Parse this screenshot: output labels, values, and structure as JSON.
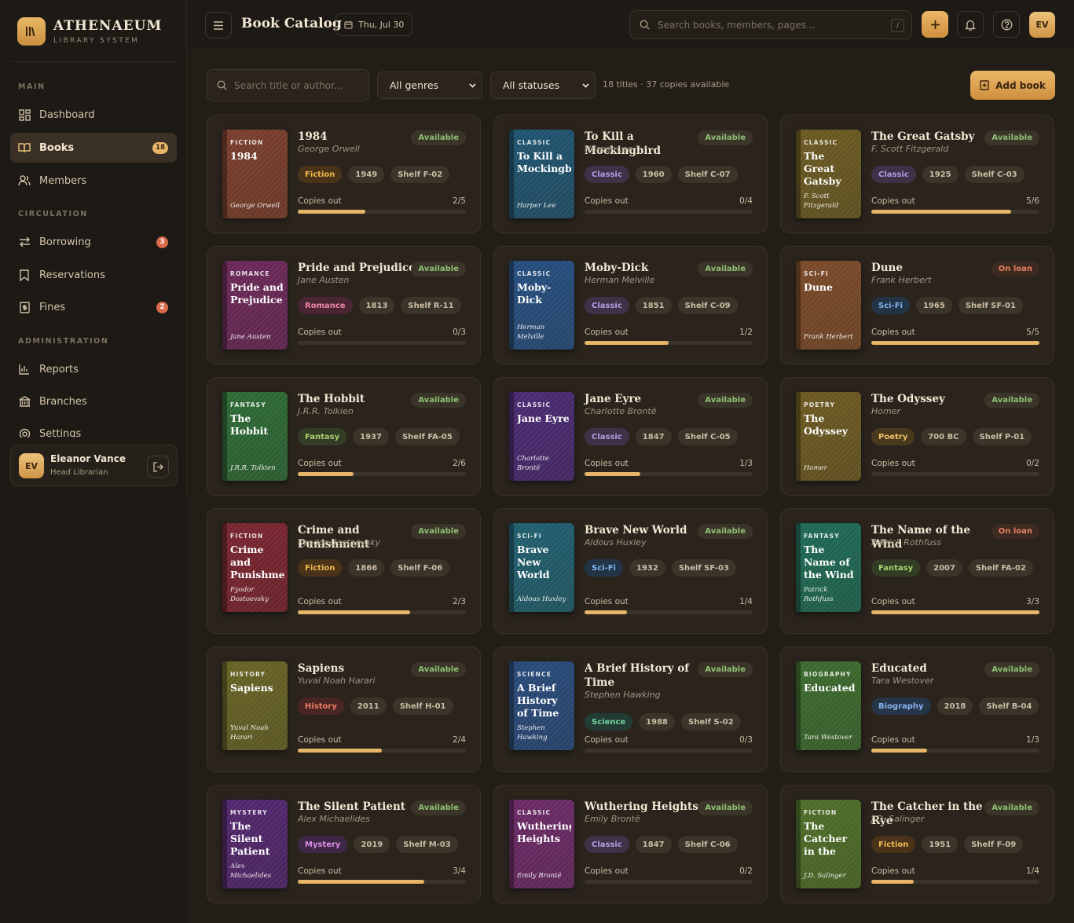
{
  "brand": {
    "name": "ATHENAEUM",
    "subtitle": "LIBRARY SYSTEM"
  },
  "sidebar": {
    "sections": {
      "main": "MAIN",
      "circulation": "CIRCULATION",
      "administration": "ADMINISTRATION"
    },
    "items": [
      {
        "label": "Dashboard",
        "icon": "grid-icon"
      },
      {
        "label": "Books",
        "icon": "book-icon",
        "badge": "18",
        "active": true
      },
      {
        "label": "Members",
        "icon": "users-icon"
      },
      {
        "label": "Borrowing",
        "icon": "swap-icon",
        "badge": "3"
      },
      {
        "label": "Reservations",
        "icon": "bookmark-icon"
      },
      {
        "label": "Fines",
        "icon": "receipt-icon",
        "badge": "2"
      },
      {
        "label": "Reports",
        "icon": "bar-chart-icon"
      },
      {
        "label": "Branches",
        "icon": "building-icon"
      },
      {
        "label": "Settings",
        "icon": "gear-icon"
      }
    ],
    "user": {
      "initials": "EV",
      "name": "Eleanor Vance",
      "role": "Head Librarian"
    }
  },
  "topbar": {
    "title": "Book Catalog",
    "date": "Thu, Jul 30",
    "search_placeholder": "Search books, members, pages...",
    "search_shortcut": "/",
    "user_initials": "EV"
  },
  "filters": {
    "search_placeholder": "Search title or author...",
    "genre": "All genres",
    "status": "All statuses",
    "summary": "18 titles · 37 copies available",
    "add_label": "Add book"
  },
  "copies_label": "Copies out",
  "colors": {
    "accent": "#e6b567",
    "available": "#8fbf74",
    "on_loan": "#e7805e"
  },
  "books": [
    {
      "title": "1984",
      "author": "George Orwell",
      "genre": "Fiction",
      "year": "1949",
      "shelf": "Shelf F-02",
      "status": "Available",
      "out": "2/5",
      "frac": 0.4,
      "cover": "#7a3e2c"
    },
    {
      "title": "To Kill a Mockingbird",
      "author": "Harper Lee",
      "genre": "Classic",
      "year": "1960",
      "shelf": "Shelf C-07",
      "status": "Available",
      "out": "0/4",
      "frac": 0,
      "cover": "#1f5470"
    },
    {
      "title": "The Great Gatsby",
      "author": "F. Scott Fitzgerald",
      "genre": "Classic",
      "year": "1925",
      "shelf": "Shelf C-03",
      "status": "Available",
      "out": "5/6",
      "frac": 0.833,
      "cover": "#6b5a22"
    },
    {
      "title": "Pride and Prejudice",
      "author": "Jane Austen",
      "genre": "Romance",
      "year": "1813",
      "shelf": "Shelf R-11",
      "status": "Available",
      "out": "0/3",
      "frac": 0,
      "cover": "#6b2858"
    },
    {
      "title": "Moby-Dick",
      "author": "Herman Melville",
      "genre": "Classic",
      "year": "1851",
      "shelf": "Shelf C-09",
      "status": "Available",
      "out": "1/2",
      "frac": 0.5,
      "cover": "#254e7f"
    },
    {
      "title": "Dune",
      "author": "Frank Herbert",
      "genre": "Sci-Fi",
      "year": "1965",
      "shelf": "Shelf SF-01",
      "status": "On loan",
      "out": "5/5",
      "frac": 1,
      "cover": "#7a4a28"
    },
    {
      "title": "The Hobbit",
      "author": "J.R.R. Tolkien",
      "genre": "Fantasy",
      "year": "1937",
      "shelf": "Shelf FA-05",
      "status": "Available",
      "out": "2/6",
      "frac": 0.333,
      "cover": "#2d6a35"
    },
    {
      "title": "Jane Eyre",
      "author": "Charlotte Brontë",
      "genre": "Classic",
      "year": "1847",
      "shelf": "Shelf C-05",
      "status": "Available",
      "out": "1/3",
      "frac": 0.333,
      "cover": "#4a2a72"
    },
    {
      "title": "The Odyssey",
      "author": "Homer",
      "genre": "Poetry",
      "year": "700 BC",
      "shelf": "Shelf P-01",
      "status": "Available",
      "out": "0/2",
      "frac": 0,
      "cover": "#6d5a22"
    },
    {
      "title": "Crime and Punishment",
      "author": "Fyodor Dostoevsky",
      "genre": "Fiction",
      "year": "1866",
      "shelf": "Shelf F-06",
      "status": "Available",
      "out": "2/3",
      "frac": 0.667,
      "cover": "#7a2530"
    },
    {
      "title": "Brave New World",
      "author": "Aldous Huxley",
      "genre": "Sci-Fi",
      "year": "1932",
      "shelf": "Shelf SF-03",
      "status": "Available",
      "out": "1/4",
      "frac": 0.25,
      "cover": "#205f6f"
    },
    {
      "title": "The Name of the Wind",
      "author": "Patrick Rothfuss",
      "genre": "Fantasy",
      "year": "2007",
      "shelf": "Shelf FA-02",
      "status": "On loan",
      "out": "3/3",
      "frac": 1,
      "cover": "#1e6a55"
    },
    {
      "title": "Sapiens",
      "author": "Yuval Noah Harari",
      "genre": "History",
      "year": "2011",
      "shelf": "Shelf H-01",
      "status": "Available",
      "out": "2/4",
      "frac": 0.5,
      "cover": "#676325"
    },
    {
      "title": "A Brief History of Time",
      "author": "Stephen Hawking",
      "genre": "Science",
      "year": "1988",
      "shelf": "Shelf S-02",
      "status": "Available",
      "out": "0/3",
      "frac": 0,
      "cover": "#284a7a"
    },
    {
      "title": "Educated",
      "author": "Tara Westover",
      "genre": "Biography",
      "year": "2018",
      "shelf": "Shelf B-04",
      "status": "Available",
      "out": "1/3",
      "frac": 0.333,
      "cover": "#3c6a2e"
    },
    {
      "title": "The Silent Patient",
      "author": "Alex Michaelides",
      "genre": "Mystery",
      "year": "2019",
      "shelf": "Shelf M-03",
      "status": "Available",
      "out": "3/4",
      "frac": 0.75,
      "cover": "#52276e"
    },
    {
      "title": "Wuthering Heights",
      "author": "Emily Brontë",
      "genre": "Classic",
      "year": "1847",
      "shelf": "Shelf C-06",
      "status": "Available",
      "out": "0/2",
      "frac": 0,
      "cover": "#6b2a66"
    },
    {
      "title": "The Catcher in the Rye",
      "author": "J.D. Salinger",
      "genre": "Fiction",
      "year": "1951",
      "shelf": "Shelf F-09",
      "status": "Available",
      "out": "1/4",
      "frac": 0.25,
      "cover": "#4e6e28"
    }
  ]
}
